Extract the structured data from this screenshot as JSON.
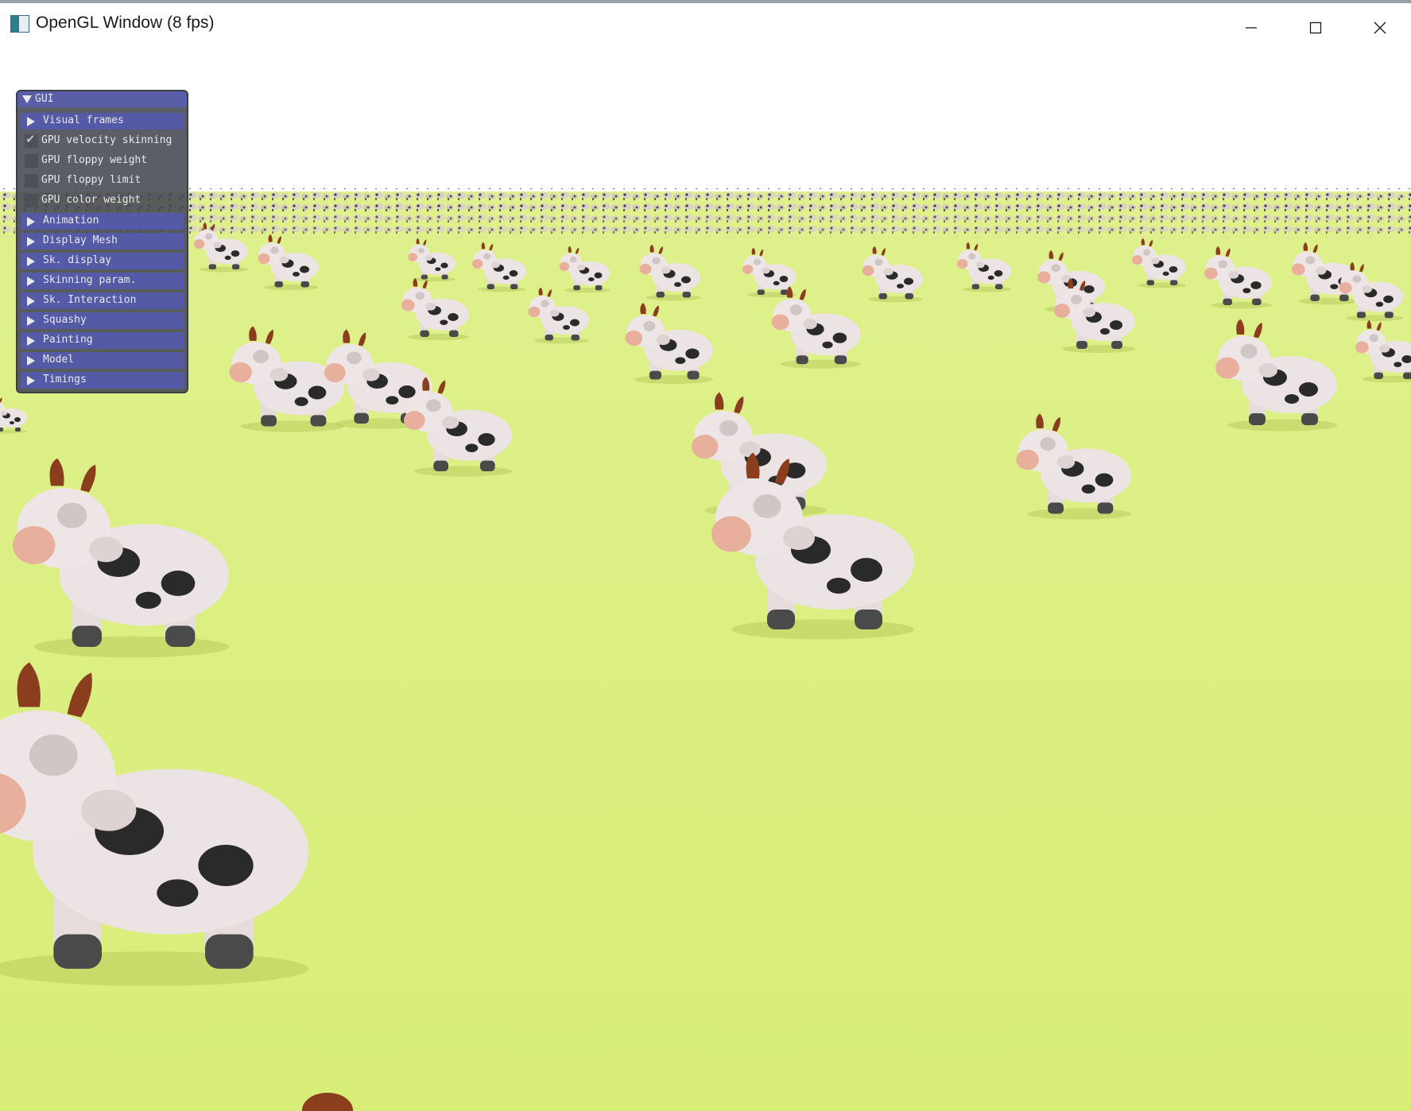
{
  "window": {
    "title": "OpenGL Window (8 fps)",
    "controls": {
      "minimize": "minimize-icon",
      "maximize": "maximize-icon",
      "close": "close-icon"
    }
  },
  "colors": {
    "sky": "#ffffff",
    "ground": "#d8ee7a",
    "gui_header": "#555aa6",
    "gui_bg": "#464852"
  },
  "gui": {
    "title": "GUI",
    "items": [
      {
        "type": "header",
        "label": "Visual frames"
      },
      {
        "type": "checkbox",
        "label": "GPU velocity skinning",
        "checked": true
      },
      {
        "type": "checkbox",
        "label": "GPU floppy weight",
        "checked": false
      },
      {
        "type": "checkbox",
        "label": "GPU floppy limit",
        "checked": false
      },
      {
        "type": "checkbox",
        "label": "GPU color weight",
        "checked": false
      },
      {
        "type": "header",
        "label": "Animation"
      },
      {
        "type": "header",
        "label": "Display Mesh"
      },
      {
        "type": "header",
        "label": "Sk. display"
      },
      {
        "type": "header",
        "label": "Skinning param."
      },
      {
        "type": "header",
        "label": "Sk. Interaction"
      },
      {
        "type": "header",
        "label": "Squashy"
      },
      {
        "type": "header",
        "label": "Painting"
      },
      {
        "type": "header",
        "label": "Model"
      },
      {
        "type": "header",
        "label": "Timings"
      }
    ]
  }
}
